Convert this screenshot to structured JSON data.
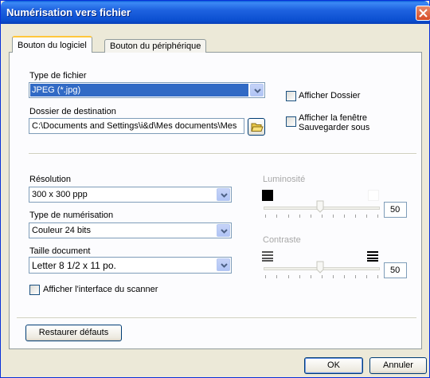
{
  "window": {
    "title": "Numérisation vers fichier"
  },
  "tabs": [
    {
      "label": "Bouton du logiciel",
      "active": true
    },
    {
      "label": "Bouton du périphérique",
      "active": false
    }
  ],
  "file_type": {
    "label": "Type de fichier",
    "value": "JPEG (*.jpg)"
  },
  "destination": {
    "label": "Dossier de destination",
    "value": "C:\\Documents and Settings\\i&d\\Mes documents\\Mes"
  },
  "checks": {
    "show_folder": {
      "label": "Afficher Dossier",
      "checked": false
    },
    "save_as_line1": "Afficher la fenêtre",
    "save_as_line2": "Sauvegarder sous",
    "show_scanner_ui": {
      "label": "Afficher l'interface du scanner",
      "checked": false
    }
  },
  "resolution": {
    "label": "Résolution",
    "value": "300 x 300 ppp"
  },
  "scan_type": {
    "label": "Type de numérisation",
    "value": "Couleur 24 bits"
  },
  "doc_size": {
    "label": "Taille document",
    "value": "Letter 8 1/2 x 11 po."
  },
  "brightness": {
    "label": "Luminosité",
    "value": "50"
  },
  "contrast": {
    "label": "Contraste",
    "value": "50"
  },
  "buttons": {
    "restore": "Restaurer défauts",
    "ok": "OK",
    "cancel": "Annuler"
  },
  "icons": {
    "close": "close-icon",
    "dropdown": "chevron-down-icon",
    "folder": "folder-open-icon",
    "brightness_low": "dark-square-icon",
    "brightness_high": "light-square-icon",
    "contrast_low": "low-contrast-icon",
    "contrast_high": "high-contrast-icon"
  },
  "colors": {
    "titlebar": "#0b4fd0",
    "selection": "#316ac5",
    "tab_highlight": "#ffc73c",
    "close": "#d64b27"
  }
}
